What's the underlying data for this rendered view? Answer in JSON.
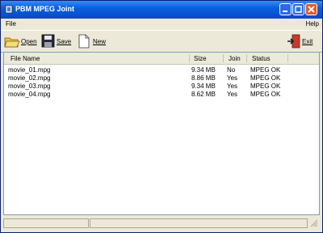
{
  "window": {
    "title": "PBM MPEG Joint"
  },
  "menu": {
    "file": "File",
    "help": "Help"
  },
  "toolbar": {
    "open": "Open",
    "save": "Save",
    "new": "New",
    "exit": "Exit"
  },
  "columns": [
    "File Name",
    "Size",
    "Join",
    "Status"
  ],
  "rows": [
    {
      "name": "movie_01.mpg",
      "size": "9.34 MB",
      "join": "No",
      "status": "MPEG OK"
    },
    {
      "name": "movie_02.mpg",
      "size": "8.86 MB",
      "join": "Yes",
      "status": "MPEG OK"
    },
    {
      "name": "movie_03.mpg",
      "size": "9.34 MB",
      "join": "Yes",
      "status": "MPEG OK"
    },
    {
      "name": "movie_04.mpg",
      "size": "8.62 MB",
      "join": "Yes",
      "status": "MPEG OK"
    }
  ],
  "colors": {
    "titlebar": "#0a5fe0",
    "close": "#e25a2a",
    "chrome": "#ece9d8"
  }
}
